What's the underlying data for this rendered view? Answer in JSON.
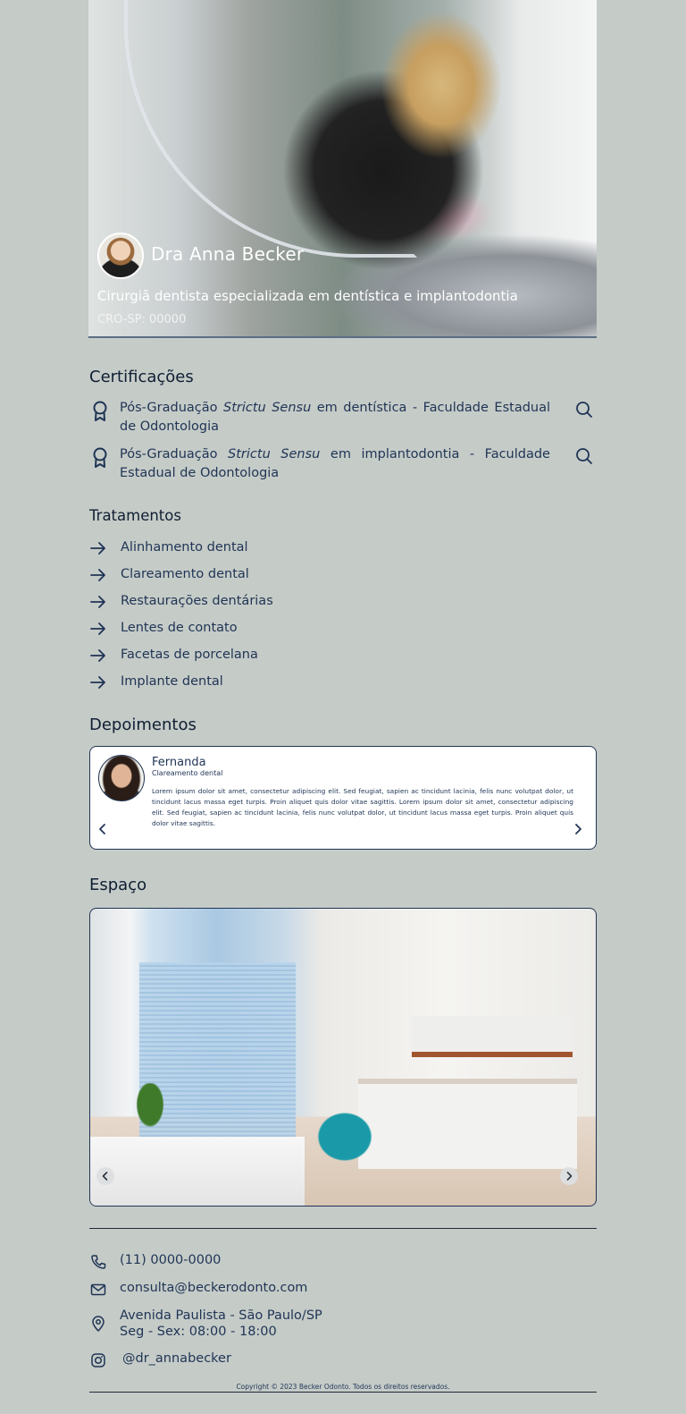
{
  "hero": {
    "name": "Dra Anna Becker",
    "subtitle": "Cirurgiã dentista especializada em dentística e implantodontia",
    "cro": "CRO-SP: 00000"
  },
  "certifications": {
    "title": "Certificações",
    "items": [
      {
        "prefix": "Pós-Graduação ",
        "emphasis": "Strictu Sensu",
        "suffix": " em dentística - Faculdade Estadual de Odontologia"
      },
      {
        "prefix": "Pós-Graduação ",
        "emphasis": "Strictu Sensu",
        "suffix": " em implantodontia - Faculdade Estadual de Odontologia"
      }
    ],
    "icon": "ribbon-icon",
    "action_icon": "search-icon"
  },
  "treatments": {
    "title": "Tratamentos",
    "items": [
      "Alinhamento dental",
      "Clareamento dental",
      "Restaurações dentárias",
      "Lentes de contato",
      "Facetas de porcelana",
      "Implante dental"
    ]
  },
  "testimonials": {
    "title": "Depoimentos",
    "current": {
      "name": "Fernanda",
      "treatment": "Clareamento dental",
      "text": "Lorem ipsum dolor sit amet, consectetur adipiscing elit. Sed feugiat, sapien ac tincidunt lacinia, felis nunc volutpat dolor, ut tincidunt lacus massa eget turpis. Proin aliquet quis dolor vitae sagittis. Lorem ipsum dolor sit amet, consectetur adipiscing elit. Sed feugiat, sapien ac tincidunt lacinia, felis nunc volutpat dolor, ut tincidunt lacus massa eget turpis. Proin aliquet quis dolor vitae sagittis."
    }
  },
  "space": {
    "title": "Espaço"
  },
  "contact": {
    "phone": "(11) 0000-0000",
    "email": "consulta@beckerodonto.com",
    "address_line1": "Avenida Paulista - São Paulo/SP",
    "address_line2": "Seg - Sex: 08:00 - 18:00",
    "instagram": "@dr_annabecker"
  },
  "footer": {
    "copyright": "Copyright © 2023 Becker Odonto. Todos os direitos reservados."
  },
  "colors": {
    "background": "#c5cbc7",
    "primary_text": "#1f3455",
    "card": "#ffffff"
  }
}
